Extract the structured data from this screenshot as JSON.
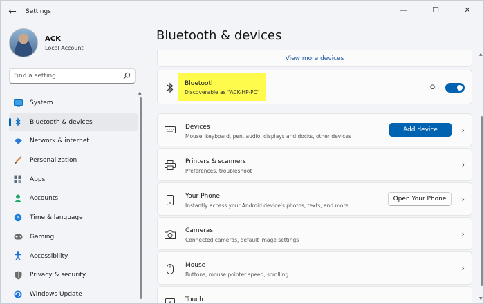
{
  "window": {
    "title": "Settings",
    "controls": [
      "—",
      "☐",
      "✕"
    ]
  },
  "profile": {
    "name": "ACK",
    "account_type": "Local Account"
  },
  "search": {
    "placeholder": "Find a setting"
  },
  "sidebar": {
    "items": [
      {
        "label": "System",
        "icon": "monitor-icon",
        "color": "#0078d4"
      },
      {
        "label": "Bluetooth & devices",
        "icon": "bluetooth-icon",
        "color": "#0067c0",
        "active": true
      },
      {
        "label": "Network & internet",
        "icon": "wifi-icon",
        "color": "#2b7bd6"
      },
      {
        "label": "Personalization",
        "icon": "brush-icon",
        "color": "#d07a2f"
      },
      {
        "label": "Apps",
        "icon": "apps-icon",
        "color": "#5a6b7c"
      },
      {
        "label": "Accounts",
        "icon": "person-icon",
        "color": "#1fa86b"
      },
      {
        "label": "Time & language",
        "icon": "globe-clock-icon",
        "color": "#1d7fd8"
      },
      {
        "label": "Gaming",
        "icon": "gamepad-icon",
        "color": "#6b6b6b"
      },
      {
        "label": "Accessibility",
        "icon": "accessibility-icon",
        "color": "#1a6fd0"
      },
      {
        "label": "Privacy & security",
        "icon": "shield-icon",
        "color": "#6b6b6b"
      },
      {
        "label": "Windows Update",
        "icon": "update-icon",
        "color": "#1a73d9"
      }
    ]
  },
  "main": {
    "title": "Bluetooth & devices",
    "view_more": "View more devices",
    "bluetooth": {
      "title": "Bluetooth",
      "subtitle": "Discoverable as \"ACK-HP-PC\"",
      "status": "On",
      "enabled": true
    },
    "rows": [
      {
        "title": "Devices",
        "subtitle": "Mouse, keyboard, pen, audio, displays and docks, other devices",
        "icon": "keyboard-device-icon",
        "button": "Add device"
      },
      {
        "title": "Printers & scanners",
        "subtitle": "Preferences, troubleshoot",
        "icon": "printer-icon"
      },
      {
        "title": "Your Phone",
        "subtitle": "Instantly access your Android device's photos, texts, and more",
        "icon": "phone-icon",
        "button": "Open Your Phone"
      },
      {
        "title": "Cameras",
        "subtitle": "Connected cameras, default image settings",
        "icon": "camera-icon"
      },
      {
        "title": "Mouse",
        "subtitle": "Buttons, mouse pointer speed, scrolling",
        "icon": "mouse-icon"
      },
      {
        "title": "Touch",
        "subtitle": "",
        "icon": "touch-icon"
      }
    ]
  },
  "colors": {
    "accent": "#0063b1",
    "highlight": "#fffb4d"
  }
}
